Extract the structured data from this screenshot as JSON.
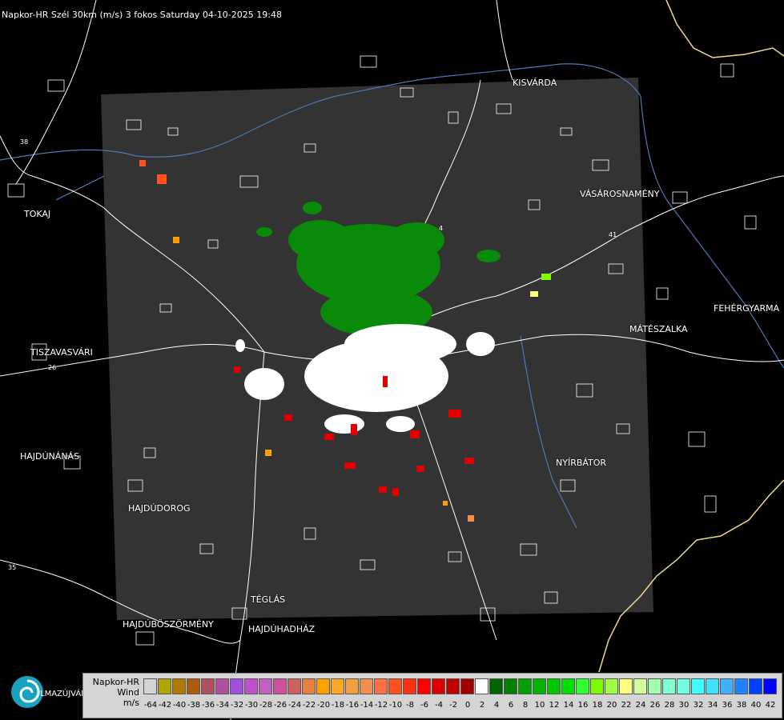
{
  "header": {
    "title": "Napkor-HR Szél 30km (m/s) 3 fokos Saturday 04-10-2025 19:48"
  },
  "cities": [
    {
      "id": "kisvarda",
      "label": "KISVÁRDA"
    },
    {
      "id": "tokaj",
      "label": "TOKAJ"
    },
    {
      "id": "vasarosnameny",
      "label": "VÁSÁROSNAMÉNY"
    },
    {
      "id": "fehergyarmat",
      "label": "FEHÉRGYARMA"
    },
    {
      "id": "mateszalka",
      "label": "MÁTÉSZALKA"
    },
    {
      "id": "tiszavasvari",
      "label": "TISZAVASVÁRI"
    },
    {
      "id": "hajdunanas",
      "label": "HAJDÚNÁNÁS"
    },
    {
      "id": "nyirbator",
      "label": "NYÍRBÁTOR"
    },
    {
      "id": "hajdudorog",
      "label": "HAJDÚDOROG"
    },
    {
      "id": "teglas",
      "label": "TÉGLÁS"
    },
    {
      "id": "hajduboszormeny",
      "label": "HAJDÚBÖSZÖRMÉNY"
    },
    {
      "id": "hajduhadhaz",
      "label": "HAJDÚHADHÁZ"
    }
  ],
  "road_numbers": [
    "38",
    "26",
    "35",
    "4",
    "41"
  ],
  "bottom_left_label": "LMAZÚJVÁR",
  "legend": {
    "title_line1": "Napkor-HR",
    "title_line2": "Wind",
    "title_line3": "m/s",
    "ticks": [
      "-64",
      "-42",
      "-40",
      "-38",
      "-36",
      "-34",
      "-32",
      "-30",
      "-28",
      "-26",
      "-24",
      "-22",
      "-20",
      "-18",
      "-16",
      "-14",
      "-12",
      "-10",
      "-8",
      "-6",
      "-4",
      "-2",
      "0",
      "2",
      "4",
      "6",
      "8",
      "10",
      "12",
      "14",
      "16",
      "18",
      "20",
      "22",
      "24",
      "26",
      "28",
      "30",
      "32",
      "34",
      "36",
      "38",
      "40",
      "42"
    ],
    "colors": [
      "#d3d3d3",
      "#b3a300",
      "#b07a00",
      "#b05a10",
      "#b05060",
      "#b050a0",
      "#a050e0",
      "#c050d0",
      "#c060c0",
      "#d050a0",
      "#d06060",
      "#e88040",
      "#ffa000",
      "#ffa828",
      "#f0a040",
      "#f09050",
      "#ff7040",
      "#ff5020",
      "#ff3010",
      "#ff0000",
      "#e00000",
      "#c00000",
      "#a00000",
      "#ffffff",
      "#006400",
      "#008000",
      "#00a000",
      "#00b400",
      "#00c800",
      "#00e000",
      "#32ff32",
      "#7cfc00",
      "#a0ff40",
      "#ffff80",
      "#d0ffa0",
      "#a0ffb0",
      "#80ffd0",
      "#70ffe0",
      "#40ffff",
      "#40e0ff",
      "#40b0ff",
      "#2080ff",
      "#0040ff",
      "#0000ff"
    ]
  },
  "style": {
    "radar_bg": "#333333",
    "road_color": "#ffffff",
    "river_color": "#4a7ab8",
    "border_color": "#f0d890"
  }
}
